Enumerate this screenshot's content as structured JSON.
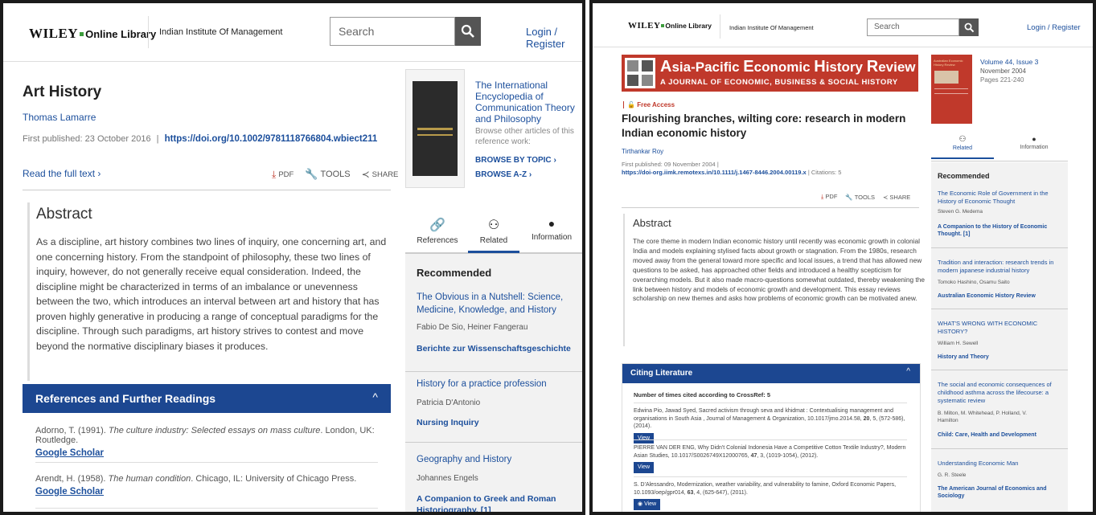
{
  "left": {
    "header": {
      "logo_wiley": "WILEY",
      "logo_online": "Online Library",
      "institution": "Indian Institute Of Management",
      "search_placeholder": "Search",
      "login_label": "Login / Register"
    },
    "article": {
      "title": "Art History",
      "author": "Thomas Lamarre",
      "first_published_label": "First published:",
      "first_published_date": "23 October 2016",
      "separator": "|",
      "doi": "https://doi.org/10.1002/9781118766804.wbiect211",
      "read_full_text": "Read the full text",
      "pdf_label": "PDF",
      "tools_label": "TOOLS",
      "share_label": "SHARE"
    },
    "book": {
      "title": "The International Encyclopedia of Communication Theory and Philosophy",
      "browse_text": "Browse other articles of this reference work:",
      "browse_topic": "BROWSE BY TOPIC",
      "browse_az": "BROWSE A-Z"
    },
    "abstract": {
      "heading": "Abstract",
      "text": "As a discipline, art history combines two lines of inquiry, one concerning art, and one concerning history. From the standpoint of philosophy, these two lines of inquiry, however, do not generally receive equal consideration. Indeed, the discipline might be characterized in terms of an imbalance or unevenness between the two, which introduces an interval between art and history that has proven highly generative in producing a range of conceptual paradigms for the discipline. Through such paradigms, art history strives to contest and move beyond the normative disciplinary biases it produces."
    },
    "references": {
      "heading": "References and Further Readings",
      "items": [
        {
          "pre": "Adorno, T. (1991). ",
          "em": "The culture industry: Selected essays on mass culture",
          "post": ". London, UK: Routledge.",
          "link": "Google Scholar"
        },
        {
          "pre": "Arendt, H. (1958). ",
          "em": "The human condition",
          "post": ". Chicago, IL: University of Chicago Press.",
          "link": "Google Scholar"
        }
      ]
    },
    "tabs": [
      {
        "label": "References",
        "icon": "link-icon"
      },
      {
        "label": "Related",
        "icon": "related-icon"
      },
      {
        "label": "Information",
        "icon": "info-icon"
      }
    ],
    "recommended": {
      "heading": "Recommended",
      "items": [
        {
          "title": "The Obvious in a Nutshell: Science, Medicine, Knowledge, and History",
          "authors": "Fabio De Sio, Heiner Fangerau",
          "source": "Berichte zur Wissenschaftsgeschichte"
        },
        {
          "title": "History for a practice profession",
          "authors": "Patricia D'Antonio",
          "source": "Nursing Inquiry"
        },
        {
          "title": "Geography and History",
          "authors": "Johannes Engels",
          "source": "A Companion to Greek and Roman Historiography. [1]"
        }
      ]
    }
  },
  "right": {
    "header": {
      "logo_wiley": "WILEY",
      "logo_online": "Online Library",
      "institution": "Indian Institute Of Management",
      "search_placeholder": "Search",
      "login_label": "Login / Register"
    },
    "journal": {
      "name_a": "A",
      "name_rest": "sia-Pacific ",
      "name_e": "E",
      "name_rest2": "conomic ",
      "name_h": "H",
      "name_rest3": "istory ",
      "name_r": "R",
      "name_rest4": "eview",
      "subtitle": "A JOURNAL OF ECONOMIC, BUSINESS & SOCIAL HISTORY",
      "volume": "Volume 44, Issue 3",
      "date": "November 2004",
      "pages": "Pages 221-240",
      "cover_text": "Australian Economic History Review"
    },
    "article": {
      "free_access": "Free Access",
      "title": "Flourishing branches, wilting core: research in modern Indian economic history",
      "author": "Tirthankar Roy",
      "first_published": "First published: 09 November 2004 |",
      "doi": "https://doi-org.iimk.remotexs.in/10.1111/j.1467-8446.2004.00119.x",
      "citations_label": "| Citations: 5",
      "pdf_label": "PDF",
      "tools_label": "TOOLS",
      "share_label": "SHARE"
    },
    "abstract": {
      "heading": "Abstract",
      "text": "The core theme in modern Indian economic history until recently was economic growth in colonial India and models explaining stylised facts about growth or stagnation. From the 1980s, research moved away from the general toward more specific and local issues, a trend that has allowed new questions to be asked, has approached other fields and introduced a healthy scepticism for overarching models. But it also made macro-questions somewhat outdated, thereby weakening the link between history and models of economic growth and development. This essay reviews scholarship on new themes and asks how problems of economic growth can be motivated anew."
    },
    "citing": {
      "heading": "Citing Literature",
      "count_label": "Number of times cited according to CrossRef: 5",
      "items": [
        {
          "text": "Edwina Pio, Jawad Syed, Sacred activism through seva and khidmat : Contextualising management and organisations in South Asia , Journal of Management & Organization, 10.1017/jmo.2014.58, ",
          "bold": "20",
          "post": ", 5, (572-586), (2014).",
          "view": "View"
        },
        {
          "text": "PIERRE VAN DER ENG, Why Didn't Colonial Indonesia Have a Competitive Cotton Textile Industry?, Modern Asian Studies, 10.1017/S0026749X12000765, ",
          "bold": "47",
          "post": ", 3, (1019-1054), (2012).",
          "view": "View"
        },
        {
          "text": "S. D'Alessandro, Modernization, weather variability, and vulnerability to famine, Oxford Economic Papers, 10.1093/oep/gpr014, ",
          "bold": "63",
          "post": ", 4, (625-647), (2011).",
          "view": "View"
        }
      ]
    },
    "tabs": [
      {
        "label": "Related",
        "icon": "related-icon"
      },
      {
        "label": "Information",
        "icon": "info-icon"
      }
    ],
    "recommended": {
      "heading": "Recommended",
      "items": [
        {
          "title": "The Economic Role of Government in the History of Economic Thought",
          "authors": "Steven G. Medema",
          "source": "A Companion to the History of Economic Thought. [1]"
        },
        {
          "title": "Tradition and interaction: research trends in modern japanese industrial history",
          "authors": "Tomoko Hashino, Osamu Saito",
          "source": "Australian Economic History Review"
        },
        {
          "title": "WHAT'S WRONG WITH ECONOMIC HISTORY?",
          "authors": "William H. Sewell",
          "source": "History and Theory"
        },
        {
          "title": "The social and economic consequences of childhood asthma across the lifecourse: a systematic review",
          "authors": "B. Milton, M. Whitehead, P. Holland, V. Hamilton",
          "source": "Child: Care, Health and Development"
        },
        {
          "title": "Understanding Economic Man",
          "authors": "G. R. Steele",
          "source": "The American Journal of Economics and Sociology"
        }
      ]
    }
  }
}
